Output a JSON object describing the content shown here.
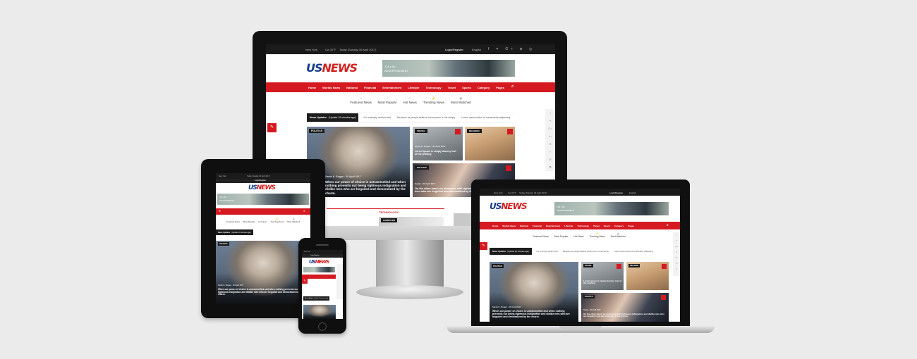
{
  "site": {
    "logo": "USNEWS",
    "top_bar": {
      "city": "New York",
      "weather": "Cw 32°F",
      "date": "Today (Sunday 30 April 2017)",
      "login": "Login/Register",
      "language": "English"
    },
    "ad": {
      "size": "728 x 90",
      "label": "ADVERTISEMENT"
    },
    "nav_items": [
      "Home",
      "Worlds News",
      "National",
      "Financial",
      "Entertainment",
      "Lifestyle",
      "Technology",
      "Travel",
      "Sports",
      "Category",
      "Pages"
    ],
    "tabs": [
      "Featured News",
      "Most Popular",
      "Hot News",
      "Trending News",
      "Most Watched"
    ],
    "ticker": {
      "label": "News Updates",
      "sub": "(Update 10 minutes ago)",
      "items": [
        "It is a simply random text",
        "Because as people believe lorem ipsum is not simply",
        "Lorem ipsum dolor sit consectetur adipiscing"
      ]
    },
    "cards": {
      "main": {
        "badge": "POLITICS",
        "meta": "Sarah K. Rogan · 30 April 2017",
        "title": "When our power of choice is untrammelled and when nothing prevents our being righteous indignation and dislike men who are beguiled and demoralized by the charm."
      },
      "travel": {
        "badge": "TRAVEL",
        "meta": "Sarah K. Rogan · 30 April 2017",
        "title": "Lorem ipsum is simply dummy text of the printing"
      },
      "religion": {
        "badge": "RELIGION",
        "meta": "",
        "title": ""
      },
      "politics2": {
        "badge": "POLITICS",
        "meta": "Sarah · 30 April 2017",
        "title": "On the other hand, we denounce with righteous indignation and dislike men who are beguiled and demoralized by the charms"
      },
      "technology": "TECHNOLOGY",
      "computer": "COMPUTER"
    },
    "phone_ticker": {
      "label": "News Updates",
      "sub": "(Update 10 minutes ago)"
    }
  },
  "colors": {
    "accent": "#d51920",
    "topbar": "#1b1b1b",
    "logo_blue": "#123b8c"
  },
  "icons": [
    "location-icon",
    "weather-icon",
    "calendar-icon",
    "user-icon",
    "globe-icon",
    "search-icon",
    "star-icon",
    "heart-icon",
    "fire-icon",
    "bolt-icon",
    "eye-icon",
    "pencil-icon",
    "share-icon"
  ]
}
